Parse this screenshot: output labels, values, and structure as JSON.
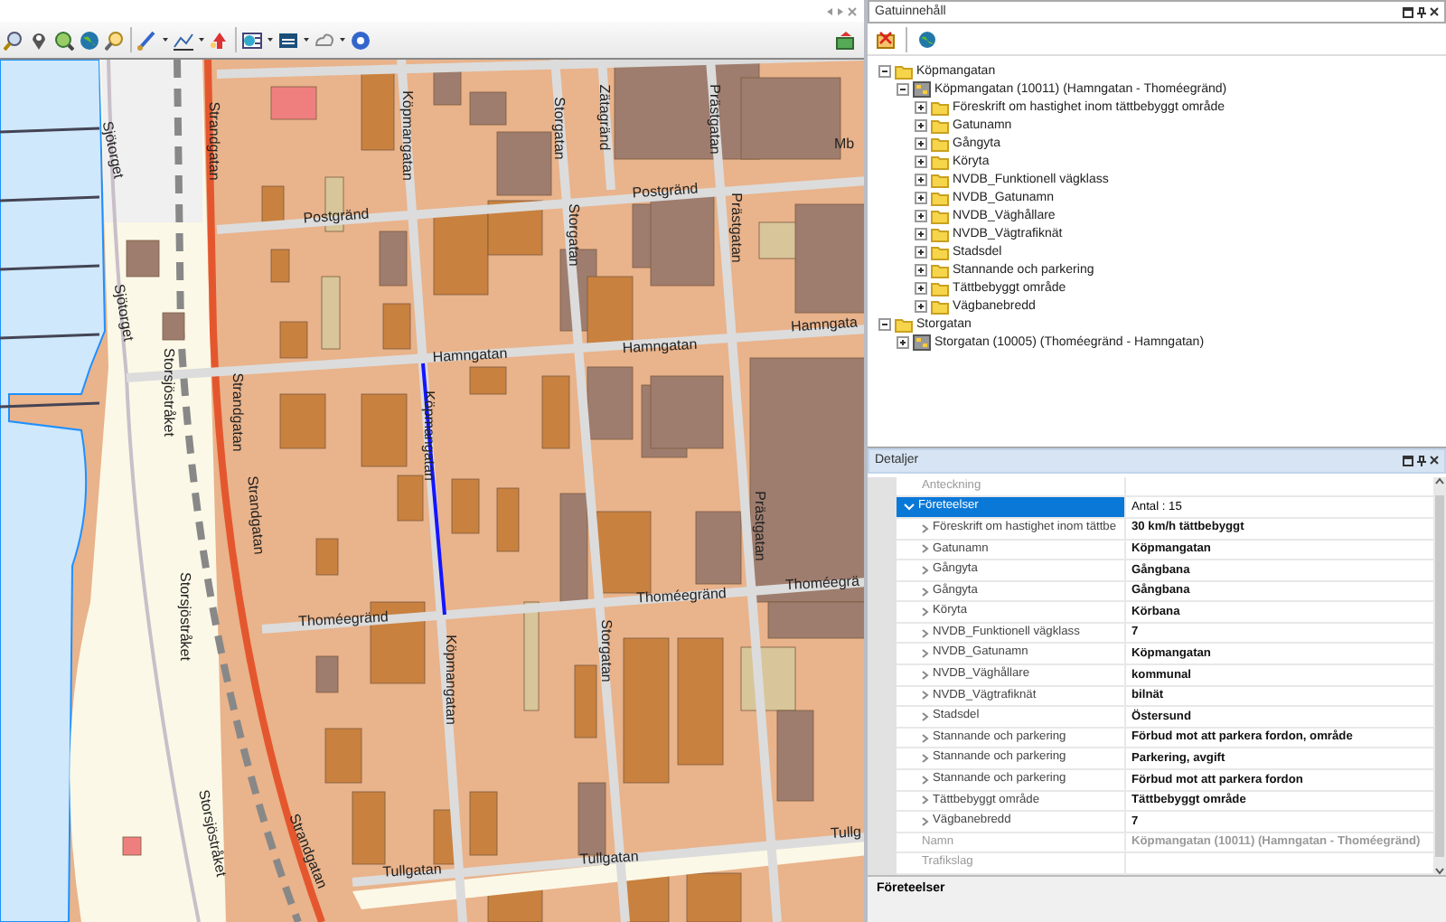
{
  "map": {
    "labels": [
      {
        "text": "Strandgatan"
      },
      {
        "text": "Sjötorget"
      },
      {
        "text": "Köpmangatan"
      },
      {
        "text": "Storgatan"
      },
      {
        "text": "Zätagränd"
      },
      {
        "text": "Prästgatan"
      },
      {
        "text": "Mb"
      },
      {
        "text": "Postgränd"
      },
      {
        "text": "Postgränd"
      },
      {
        "text": "Sjötorget"
      },
      {
        "text": "Hamngatan"
      },
      {
        "text": "Hamngatan"
      },
      {
        "text": "Hamngata"
      },
      {
        "text": "Storgatan"
      },
      {
        "text": "Prästgatan"
      },
      {
        "text": "Köpmangatan"
      },
      {
        "text": "Storsjöstråket"
      },
      {
        "text": "Strandgatan"
      },
      {
        "text": "Strandgatan"
      },
      {
        "text": "Storsjöstråket"
      },
      {
        "text": "Thoméegränd"
      },
      {
        "text": "Köpmangatan"
      },
      {
        "text": "Storgatan"
      },
      {
        "text": "Prästgatan"
      },
      {
        "text": "Thoméegränd"
      },
      {
        "text": "Thoméegrä"
      },
      {
        "text": "Storsjöstråket"
      },
      {
        "text": "Strandgatan"
      },
      {
        "text": "Tullgatan"
      },
      {
        "text": "Tullgatan"
      },
      {
        "text": "Tullg"
      }
    ]
  },
  "content_panel": {
    "title": "Gatuinnehåll",
    "tree": [
      {
        "kind": "folder",
        "label": "Köpmangatan",
        "expanded": true,
        "children": [
          {
            "kind": "street",
            "label": "Köpmangatan (10011) (Hamngatan - Thoméegränd)",
            "expanded": true,
            "children": [
              {
                "kind": "folder",
                "label": "Föreskrift om hastighet inom tättbebyggt område",
                "expanded": false
              },
              {
                "kind": "folder",
                "label": "Gatunamn",
                "expanded": false
              },
              {
                "kind": "folder",
                "label": "Gångyta",
                "expanded": false
              },
              {
                "kind": "folder",
                "label": "Köryta",
                "expanded": false
              },
              {
                "kind": "folder",
                "label": "NVDB_Funktionell vägklass",
                "expanded": false
              },
              {
                "kind": "folder",
                "label": "NVDB_Gatunamn",
                "expanded": false
              },
              {
                "kind": "folder",
                "label": "NVDB_Väghållare",
                "expanded": false
              },
              {
                "kind": "folder",
                "label": "NVDB_Vägtrafiknät",
                "expanded": false
              },
              {
                "kind": "folder",
                "label": "Stadsdel",
                "expanded": false
              },
              {
                "kind": "folder",
                "label": "Stannande och parkering",
                "expanded": false
              },
              {
                "kind": "folder",
                "label": "Tättbebyggt område",
                "expanded": false
              },
              {
                "kind": "folder",
                "label": "Vägbanebredd",
                "expanded": false
              }
            ]
          }
        ]
      },
      {
        "kind": "folder",
        "label": "Storgatan",
        "expanded": true,
        "children": [
          {
            "kind": "street",
            "label": "Storgatan (10005) (Thoméegränd - Hamngatan)",
            "expanded": false
          }
        ]
      }
    ]
  },
  "details_panel": {
    "title": "Detaljer",
    "rows": [
      {
        "kind": "property",
        "name": "Anteckning"
      },
      {
        "kind": "category",
        "name": "Företeelser",
        "value": "Antal : 15",
        "expanded": true,
        "selected": true
      },
      {
        "kind": "item",
        "name": "Föreskrift om hastighet inom tättbe",
        "value": "30 km/h tättbebyggt"
      },
      {
        "kind": "item",
        "name": "Gatunamn",
        "value": "Köpmangatan"
      },
      {
        "kind": "item",
        "name": "Gångyta",
        "value": "Gångbana"
      },
      {
        "kind": "item",
        "name": "Gångyta",
        "value": "Gångbana"
      },
      {
        "kind": "item",
        "name": "Köryta",
        "value": "Körbana"
      },
      {
        "kind": "item",
        "name": "NVDB_Funktionell vägklass",
        "value": "7"
      },
      {
        "kind": "item",
        "name": "NVDB_Gatunamn",
        "value": "Köpmangatan"
      },
      {
        "kind": "item",
        "name": "NVDB_Väghållare",
        "value": "kommunal"
      },
      {
        "kind": "item",
        "name": "NVDB_Vägtrafiknät",
        "value": "bilnät"
      },
      {
        "kind": "item",
        "name": "Stadsdel",
        "value": "Östersund"
      },
      {
        "kind": "item",
        "name": "Stannande och parkering",
        "value": "Förbud mot att parkera fordon, område"
      },
      {
        "kind": "item",
        "name": "Stannande och parkering",
        "value": "Parkering, avgift"
      },
      {
        "kind": "item",
        "name": "Stannande och parkering",
        "value": "Förbud mot att parkera fordon"
      },
      {
        "kind": "item",
        "name": "Tättbebyggt område",
        "value": "Tättbebyggt område"
      },
      {
        "kind": "item",
        "name": "Vägbanebredd",
        "value": "7"
      },
      {
        "kind": "property",
        "name": "Namn",
        "value": "Köpmangatan (10011) (Hamngatan - Thoméegränd)"
      },
      {
        "kind": "property",
        "name": "Trafikslag"
      }
    ],
    "description": {
      "title": "Företeelser"
    }
  }
}
